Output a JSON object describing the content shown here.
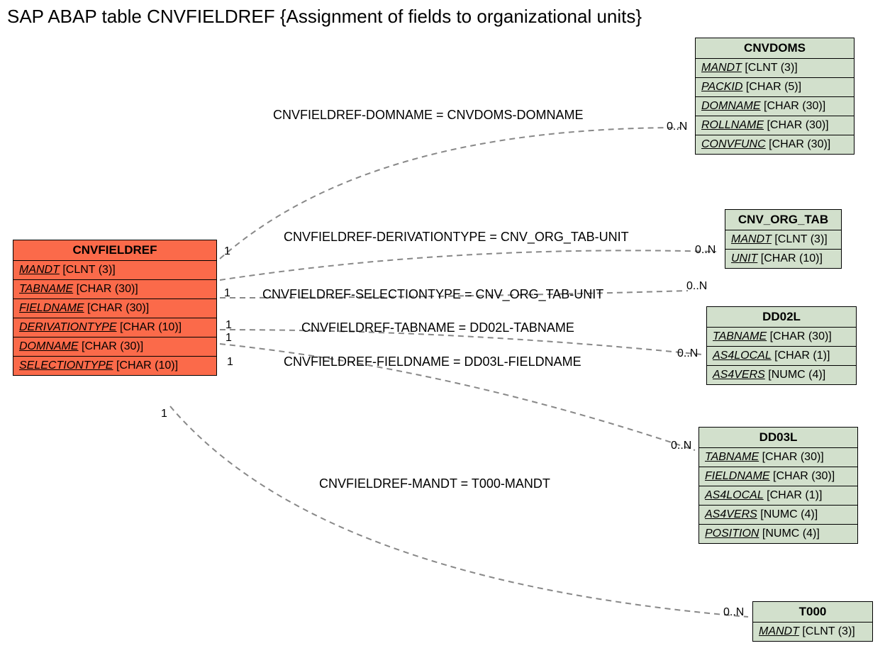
{
  "title": "SAP ABAP table CNVFIELDREF {Assignment of fields to organizational units}",
  "main": {
    "name": "CNVFIELDREF",
    "fields": [
      {
        "name": "MANDT",
        "type": "[CLNT (3)]"
      },
      {
        "name": "TABNAME",
        "type": "[CHAR (30)]"
      },
      {
        "name": "FIELDNAME",
        "type": "[CHAR (30)]"
      },
      {
        "name": "DERIVATIONTYPE",
        "type": "[CHAR (10)]"
      },
      {
        "name": "DOMNAME",
        "type": "[CHAR (30)]"
      },
      {
        "name": "SELECTIONTYPE",
        "type": "[CHAR (10)]"
      }
    ]
  },
  "rel": {
    "cnvdoms": {
      "name": "CNVDOMS",
      "fields": [
        {
          "name": "MANDT",
          "type": "[CLNT (3)]"
        },
        {
          "name": "PACKID",
          "type": "[CHAR (5)]"
        },
        {
          "name": "DOMNAME",
          "type": "[CHAR (30)]"
        },
        {
          "name": "ROLLNAME",
          "type": "[CHAR (30)]"
        },
        {
          "name": "CONVFUNC",
          "type": "[CHAR (30)]"
        }
      ]
    },
    "cnv_org_tab": {
      "name": "CNV_ORG_TAB",
      "fields": [
        {
          "name": "MANDT",
          "type": "[CLNT (3)]"
        },
        {
          "name": "UNIT",
          "type": "[CHAR (10)]"
        }
      ]
    },
    "dd02l": {
      "name": "DD02L",
      "fields": [
        {
          "name": "TABNAME",
          "type": "[CHAR (30)]"
        },
        {
          "name": "AS4LOCAL",
          "type": "[CHAR (1)]"
        },
        {
          "name": "AS4VERS",
          "type": "[NUMC (4)]"
        }
      ]
    },
    "dd03l": {
      "name": "DD03L",
      "fields": [
        {
          "name": "TABNAME",
          "type": "[CHAR (30)]"
        },
        {
          "name": "FIELDNAME",
          "type": "[CHAR (30)]"
        },
        {
          "name": "AS4LOCAL",
          "type": "[CHAR (1)]"
        },
        {
          "name": "AS4VERS",
          "type": "[NUMC (4)]"
        },
        {
          "name": "POSITION",
          "type": "[NUMC (4)]"
        }
      ]
    },
    "t000": {
      "name": "T000",
      "fields": [
        {
          "name": "MANDT",
          "type": "[CLNT (3)]"
        }
      ]
    }
  },
  "edges": {
    "e1": "CNVFIELDREF-DOMNAME = CNVDOMS-DOMNAME",
    "e2": "CNVFIELDREF-DERIVATIONTYPE = CNV_ORG_TAB-UNIT",
    "e3": "CNVFIELDREF-SELECTIONTYPE = CNV_ORG_TAB-UNIT",
    "e4": "CNVFIELDREF-TABNAME = DD02L-TABNAME",
    "e5": "CNVFIELDREF-FIELDNAME = DD03L-FIELDNAME",
    "e6": "CNVFIELDREF-MANDT = T000-MANDT"
  },
  "card": {
    "one": "1",
    "many": "0..N"
  }
}
